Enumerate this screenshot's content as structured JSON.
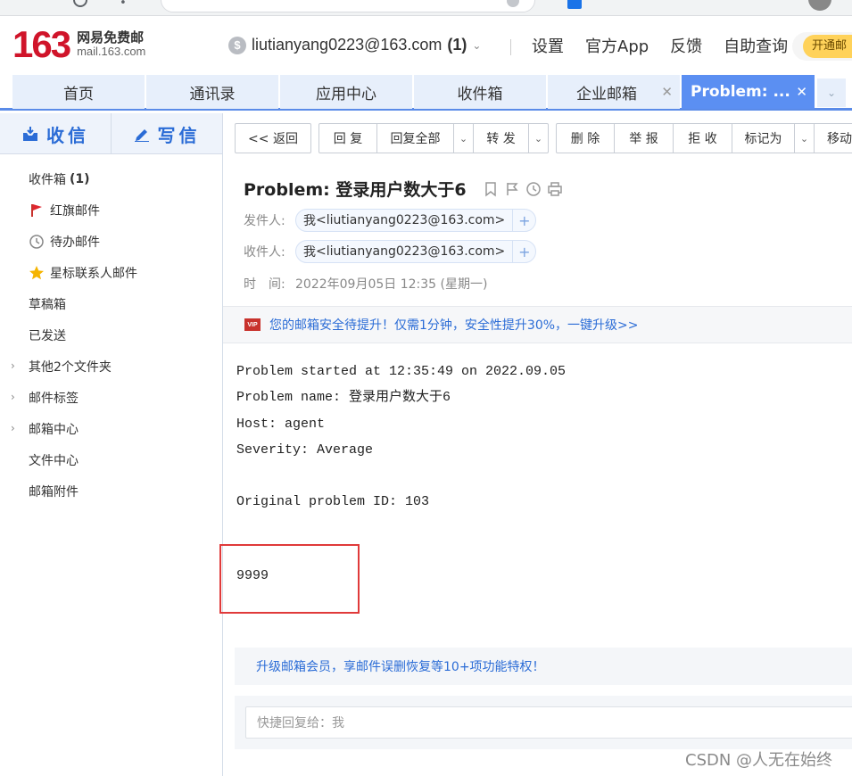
{
  "header": {
    "logo_number": "163",
    "logo_cn": "网易免费邮",
    "logo_domain": "mail.163.com",
    "account_email": "liutianyang0223@163.com",
    "account_count": "(1)",
    "links": [
      "设置",
      "官方App",
      "反馈",
      "自助查询"
    ],
    "vip_button": "开通邮"
  },
  "tabs": [
    {
      "label": "首页"
    },
    {
      "label": "通讯录"
    },
    {
      "label": "应用中心"
    },
    {
      "label": "收件箱"
    },
    {
      "label": "企业邮箱"
    },
    {
      "label": "Problem: ..."
    }
  ],
  "sidebar": {
    "receive_label": "收信",
    "compose_label": "写信",
    "folders": [
      {
        "label": "收件箱",
        "count": "(1)"
      },
      {
        "label": "红旗邮件"
      },
      {
        "label": "待办邮件"
      },
      {
        "label": "星标联系人邮件"
      },
      {
        "label": "草稿箱"
      },
      {
        "label": "已发送"
      },
      {
        "label": "其他2个文件夹"
      },
      {
        "label": "邮件标签"
      },
      {
        "label": "邮箱中心"
      },
      {
        "label": "文件中心"
      },
      {
        "label": "邮箱附件"
      }
    ]
  },
  "toolbar": {
    "back": "<< 返回",
    "reply": "回 复",
    "reply_all": "回复全部",
    "forward": "转 发",
    "delete": "删 除",
    "report": "举 报",
    "reject": "拒 收",
    "mark_as": "标记为",
    "move": "移动"
  },
  "email": {
    "subject": "Problem: 登录用户数大于6",
    "sender_label": "发件人:",
    "sender_name": "我",
    "sender_addr": "<liutianyang0223@163.com>",
    "recipient_label": "收件人:",
    "recipient_name": "我",
    "recipient_addr": "<liutianyang0223@163.com>",
    "time_label": "时　间:",
    "time_value": "2022年09月05日 12:35 (星期一)",
    "security_banner": "您的邮箱安全待提升！仅需1分钟，安全性提升30%，一键升级>>",
    "body_lines": "Problem started at 12:35:49 on 2022.09.05\nProblem name: 登录用户数大于6\nHost: agent\nSeverity: Average\n\nOriginal problem ID: 103",
    "body_extra": "9999",
    "upgrade_banner": "升级邮箱会员，享邮件误删恢复等10+项功能特权！",
    "quick_reply_placeholder": "快捷回复给：我"
  },
  "watermark": "CSDN @人无在始终",
  "colors": {
    "brand_red": "#d0142a",
    "accent_blue": "#2b6cd6",
    "active_tab": "#5b8ff2",
    "highlight_box": "#e03a3a"
  }
}
